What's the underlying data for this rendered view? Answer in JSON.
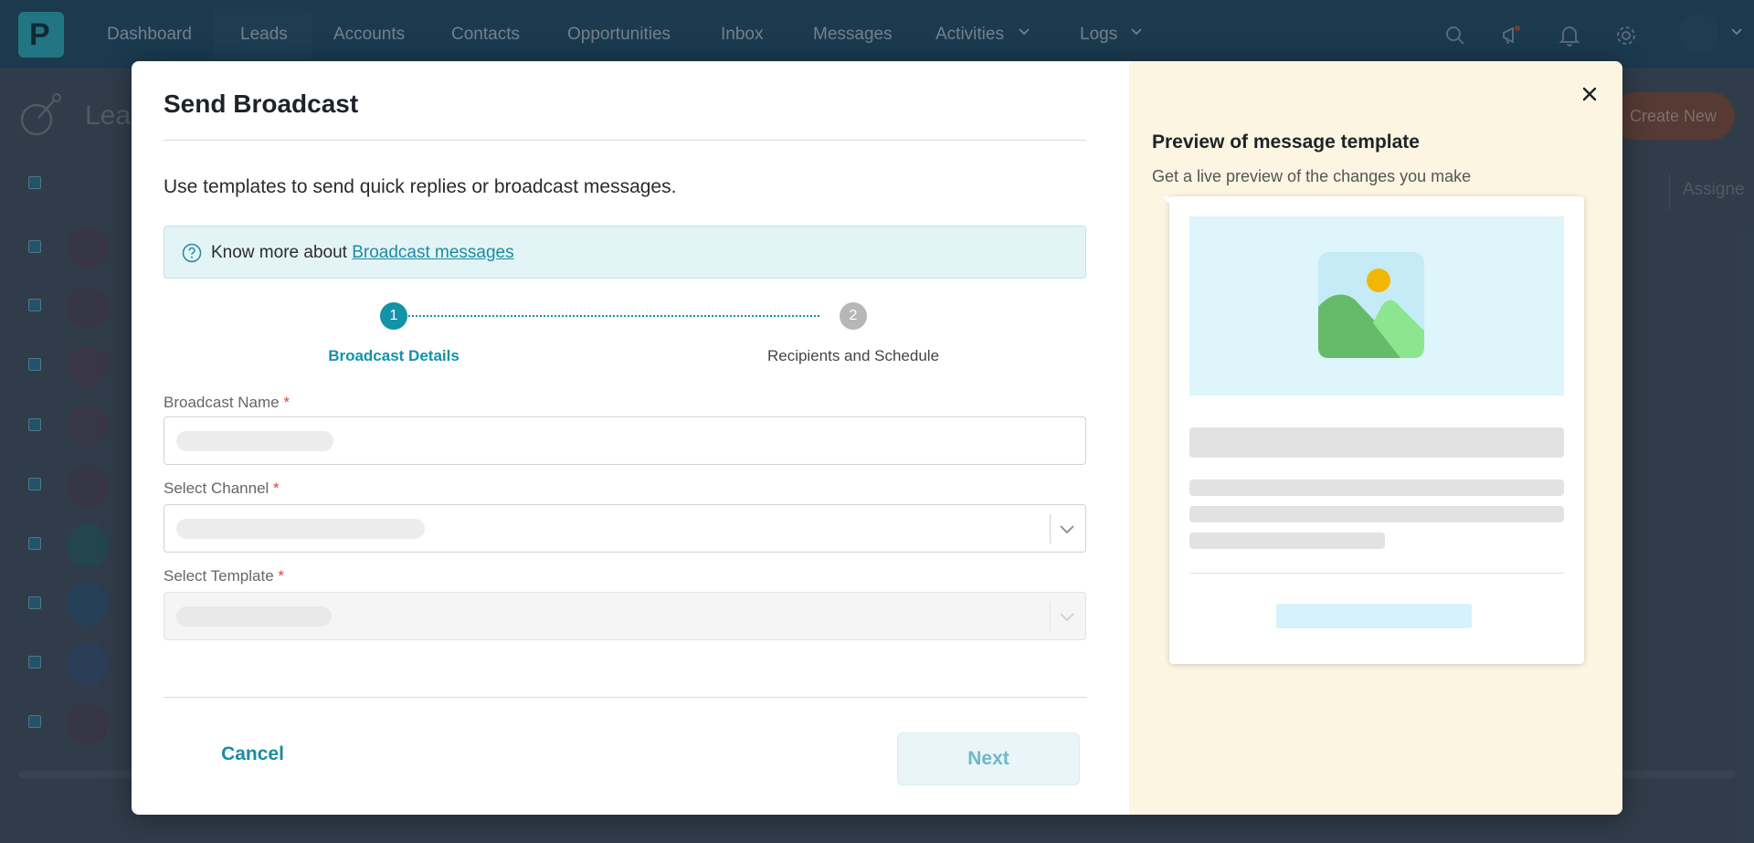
{
  "app": {
    "nav_items": [
      {
        "label": "Dashboard",
        "has_chevron": false
      },
      {
        "label": "Leads",
        "has_chevron": false,
        "active": true
      },
      {
        "label": "Accounts",
        "has_chevron": false
      },
      {
        "label": "Contacts",
        "has_chevron": false
      },
      {
        "label": "Opportunities",
        "has_chevron": false
      },
      {
        "label": "Inbox",
        "has_chevron": false
      },
      {
        "label": "Messages",
        "has_chevron": false
      },
      {
        "label": "Activities",
        "has_chevron": true
      },
      {
        "label": "Logs",
        "has_chevron": true
      }
    ],
    "page_title": "Lea",
    "create_button": "Create New",
    "assigned_column": "Assigne",
    "icons": [
      "search-icon",
      "megaphone-icon",
      "bell-icon",
      "gear-icon",
      "chevron-down-icon"
    ]
  },
  "modal": {
    "title": "Send Broadcast",
    "intro": "Use templates to send quick replies or broadcast messages.",
    "info": {
      "prefix": "Know more about ",
      "link": "Broadcast messages"
    },
    "steps": [
      {
        "number": "1",
        "label": "Broadcast Details",
        "state": "active"
      },
      {
        "number": "2",
        "label": "Recipients and Schedule",
        "state": "inactive"
      }
    ],
    "fields": {
      "name_label": "Broadcast Name",
      "channel_label": "Select Channel",
      "template_label": "Select Template",
      "required_mark": "*"
    },
    "buttons": {
      "cancel": "Cancel",
      "next": "Next"
    },
    "preview": {
      "title": "Preview of message template",
      "subtitle": "Get a live preview of the changes you make"
    }
  },
  "colors": {
    "accent": "#1293a8",
    "preview_bg": "#fbf5e1",
    "required": "#e0443a"
  }
}
